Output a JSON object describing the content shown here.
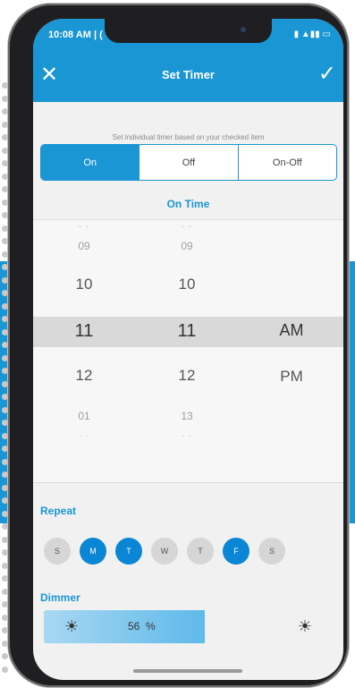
{
  "status_bar": {
    "time": "10:08 AM | ("
  },
  "header": {
    "title": "Set Timer"
  },
  "instruction": "Set individual timer based on your checked item",
  "mode_tabs": [
    {
      "label": "On",
      "selected": true
    },
    {
      "label": "Off",
      "selected": false
    },
    {
      "label": "On-Off",
      "selected": false
    }
  ],
  "section_title": "On Time",
  "picker": {
    "hours": [
      "09",
      "10",
      "11",
      "12",
      "01"
    ],
    "minutes": [
      "09",
      "10",
      "11",
      "12",
      "13"
    ],
    "meridiem": [
      "AM",
      "PM"
    ],
    "selected": {
      "hour": "11",
      "minute": "11",
      "meridiem": "AM"
    }
  },
  "repeat": {
    "label": "Repeat",
    "days": [
      {
        "label": "S",
        "active": false
      },
      {
        "label": "M",
        "active": true
      },
      {
        "label": "T",
        "active": true
      },
      {
        "label": "W",
        "active": false
      },
      {
        "label": "T",
        "active": false
      },
      {
        "label": "F",
        "active": true
      },
      {
        "label": "S",
        "active": false
      }
    ]
  },
  "dimmer": {
    "label": "Dimmer",
    "value": "56",
    "unit": "%",
    "level": 0.56
  },
  "colors": {
    "accent": "#1a96d4",
    "day_active": "#0a86d4",
    "day_inactive": "#d6d6d6"
  }
}
